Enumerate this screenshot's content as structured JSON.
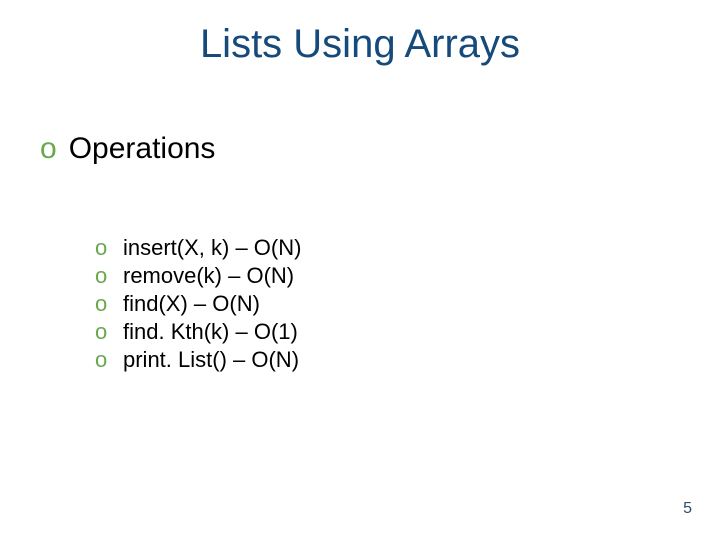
{
  "title": "Lists Using Arrays",
  "section": {
    "bullet": "o",
    "text": "Operations"
  },
  "items": [
    {
      "bullet": "o",
      "text": "insert(X, k) – O(N)"
    },
    {
      "bullet": "o",
      "text": "remove(k) – O(N)"
    },
    {
      "bullet": "o",
      "text": "find(X) – O(N)"
    },
    {
      "bullet": "o",
      "text": "find. Kth(k) – O(1)"
    },
    {
      "bullet": "o",
      "text": "print. List() – O(N)"
    }
  ],
  "page_number": "5"
}
